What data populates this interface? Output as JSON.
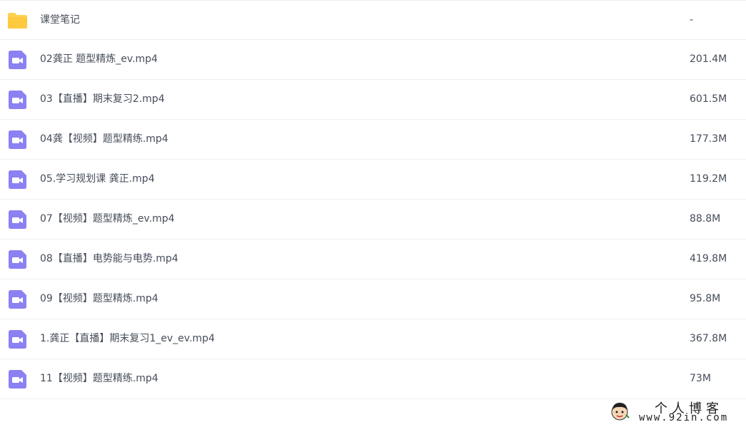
{
  "colors": {
    "folder_icon": "#ffd256",
    "video_icon": "#8b81f2",
    "text": "#454d5a",
    "divider": "#eef0f4"
  },
  "files": [
    {
      "name": "课堂笔记",
      "size": "-",
      "icon": "folder-icon"
    },
    {
      "name": "02龚正 题型精炼_ev.mp4",
      "size": "201.4M",
      "icon": "video-file-icon"
    },
    {
      "name": "03【直播】期末复习2.mp4",
      "size": "601.5M",
      "icon": "video-file-icon"
    },
    {
      "name": "04龚【视频】题型精练.mp4",
      "size": "177.3M",
      "icon": "video-file-icon"
    },
    {
      "name": "05.学习规划课 龚正.mp4",
      "size": "119.2M",
      "icon": "video-file-icon"
    },
    {
      "name": "07【视频】题型精炼_ev.mp4",
      "size": "88.8M",
      "icon": "video-file-icon"
    },
    {
      "name": "08【直播】电势能与电势.mp4",
      "size": "419.8M",
      "icon": "video-file-icon"
    },
    {
      "name": "09【视频】题型精炼.mp4",
      "size": "95.8M",
      "icon": "video-file-icon"
    },
    {
      "name": "1.龚正【直播】期末复习1_ev_ev.mp4",
      "size": "367.8M",
      "icon": "video-file-icon"
    },
    {
      "name": "11【视频】题型精练.mp4",
      "size": "73M",
      "icon": "video-file-icon"
    }
  ],
  "watermark": {
    "title": "个人博客",
    "url": "www.92in.com"
  }
}
